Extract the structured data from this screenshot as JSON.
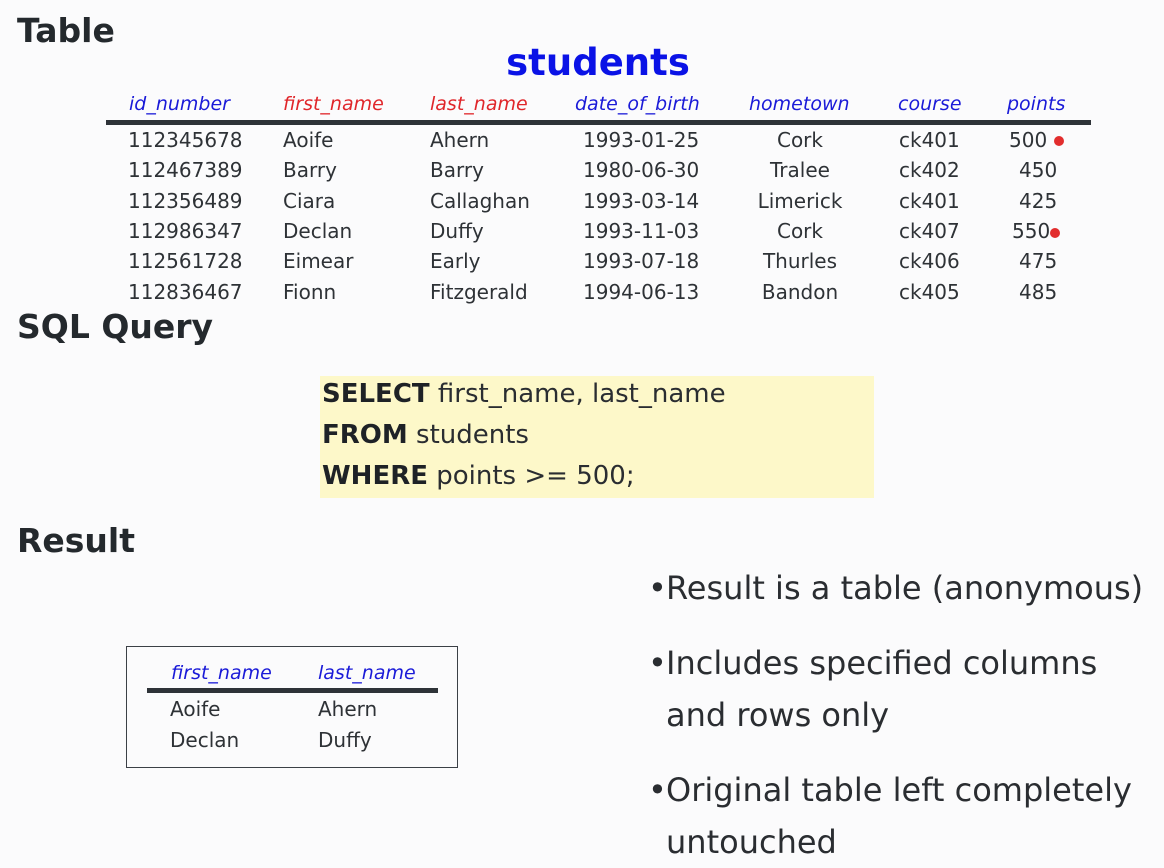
{
  "headings": {
    "table": "Table",
    "sql": "SQL Query",
    "result": "Result"
  },
  "students_table": {
    "title": "students",
    "columns": [
      {
        "label": "id_number",
        "color": "#1a1ad8"
      },
      {
        "label": "first_name",
        "color": "#e0262a"
      },
      {
        "label": "last_name",
        "color": "#e0262a"
      },
      {
        "label": "date_of_birth",
        "color": "#1a1ad8"
      },
      {
        "label": "hometown",
        "color": "#1a1ad8"
      },
      {
        "label": "course",
        "color": "#1a1ad8"
      },
      {
        "label": "points",
        "color": "#1a1ad8"
      }
    ],
    "rows": [
      [
        "112345678",
        "Aoife",
        "Ahern",
        "1993-01-25",
        "Cork",
        "ck401",
        "500"
      ],
      [
        "112467389",
        "Barry",
        "Barry",
        "1980-06-30",
        "Tralee",
        "ck402",
        "450"
      ],
      [
        "112356489",
        "Ciara",
        "Callaghan",
        "1993-03-14",
        "Limerick",
        "ck401",
        "425"
      ],
      [
        "112986347",
        "Declan",
        "Duffy",
        "1993-11-03",
        "Cork",
        "ck407",
        "550"
      ],
      [
        "112561728",
        "Eimear",
        "Early",
        "1993-07-18",
        "Thurles",
        "ck406",
        "475"
      ],
      [
        "112836467",
        "Fionn",
        "Fitzgerald",
        "1994-06-13",
        "Bandon",
        "ck405",
        "485"
      ]
    ],
    "highlight_color": "#e22d2d"
  },
  "sql": {
    "line1_kw": "SELECT",
    "line1_rest": " first_name, last_name",
    "line2_kw": "FROM",
    "line2_rest": " students",
    "line3_kw": "WHERE",
    "line3_rest": " points >= 500;",
    "background": "#fdf8c9"
  },
  "result_table": {
    "columns": [
      "first_name",
      "last_name"
    ],
    "rows": [
      [
        "Aoife",
        "Ahern"
      ],
      [
        "Declan",
        "Duffy"
      ]
    ]
  },
  "bullets": [
    {
      "line1": "Result is a table (anonymous)",
      "line2": ""
    },
    {
      "line1": "Includes specified columns",
      "line2": "and rows only"
    },
    {
      "line1": "Original table left completely",
      "line2": "untouched"
    }
  ],
  "bullet_glyph": "•"
}
